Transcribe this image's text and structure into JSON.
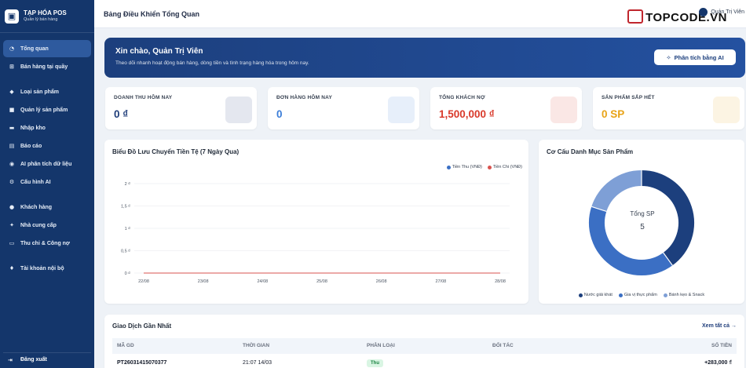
{
  "brand": {
    "title": "TẠP HÓA POS",
    "subtitle": "Quản lý bán hàng"
  },
  "sidebar": {
    "items": [
      {
        "label": "Tổng quan",
        "icon": "pie-icon",
        "active": true
      },
      {
        "label": "Bán hàng tại quầy",
        "icon": "cart-icon"
      },
      {
        "label": "Loại sản phẩm",
        "icon": "tag-icon"
      },
      {
        "label": "Quản lý sản phẩm",
        "icon": "box-icon"
      },
      {
        "label": "Nhập kho",
        "icon": "truck-icon"
      },
      {
        "label": "Báo cáo",
        "icon": "chart-icon"
      },
      {
        "label": "AI phân tích dữ liệu",
        "icon": "robot-icon"
      },
      {
        "label": "Cấu hình AI",
        "icon": "gear-icon"
      },
      {
        "label": "Khách hàng",
        "icon": "users-icon"
      },
      {
        "label": "Nhà cung cấp",
        "icon": "handshake-icon"
      },
      {
        "label": "Thu chi & Công nợ",
        "icon": "wallet-icon"
      },
      {
        "label": "Tài khoản nội bộ",
        "icon": "user-shield-icon"
      }
    ],
    "logout": "Đăng xuất"
  },
  "header": {
    "title": "Bảng Điều Khiển Tổng Quan",
    "user": "Quản Trị Viên",
    "logo_text": "TOPCODE.VN"
  },
  "banner": {
    "title": "Xin chào, Quản Trị Viên",
    "subtitle": "Theo dõi nhanh hoạt động bán hàng, dòng tiền và tình trạng hàng hóa trong hôm nay.",
    "button": "Phân tích bằng AI"
  },
  "stats": [
    {
      "label": "DOANH THU HÔM NAY",
      "value": "0 ₫",
      "color": "#1f3d7a"
    },
    {
      "label": "ĐƠN HÀNG HÔM NAY",
      "value": "0",
      "color": "#3b7dd8"
    },
    {
      "label": "TỔNG KHÁCH NỢ",
      "value": "1,500,000 ₫",
      "color": "#d93a2b"
    },
    {
      "label": "SẢN PHẨM SẮP HẾT",
      "value": "0 SP",
      "color": "#e8a317"
    }
  ],
  "cashflow": {
    "title": "Biểu Đồ Lưu Chuyển Tiền Tệ (7 Ngày Qua)",
    "chart_data": {
      "type": "line",
      "x": [
        "22/08",
        "23/08",
        "24/08",
        "25/08",
        "26/08",
        "27/08",
        "28/08"
      ],
      "y_ticks": [
        "2 ₫",
        "1,5 ₫",
        "1 ₫",
        "0,5 ₫",
        "0 ₫"
      ],
      "ylim": [
        0,
        2
      ],
      "grid": true,
      "legend": "top-right",
      "series": [
        {
          "name": "Tiền Thu (VNĐ)",
          "color": "#3b6fc4",
          "values": [
            0,
            0,
            0,
            0,
            0,
            0,
            0
          ]
        },
        {
          "name": "Tiền Chi (VNĐ)",
          "color": "#d9534f",
          "values": [
            0,
            0,
            0,
            0,
            0,
            0,
            0
          ]
        }
      ]
    }
  },
  "category": {
    "title": "Cơ Cấu Danh Mục Sản Phẩm",
    "center_label": "Tổng SP",
    "center_value": "5",
    "chart_data": {
      "type": "pie",
      "categories": [
        "Nước giải khát",
        "Gia vị thực phẩm",
        "Bánh kẹo & Snack"
      ],
      "values": [
        2,
        2,
        1
      ],
      "colors": [
        "#1c3f7d",
        "#3b6fc4",
        "#7e9fd6"
      ],
      "legend": "bottom"
    }
  },
  "transactions": {
    "title": "Giao Dịch Gần Nhất",
    "see_all": "Xem tất cả",
    "columns": [
      "MÃ GD",
      "THỜI GIAN",
      "PHÂN LOẠI",
      "ĐỐI TÁC",
      "SỐ TIỀN"
    ],
    "rows": [
      {
        "id": "PT26031415070377",
        "time": "21:07 14/03",
        "type": "Thu",
        "partner": "",
        "amount": "+283,000 ₫"
      }
    ]
  }
}
